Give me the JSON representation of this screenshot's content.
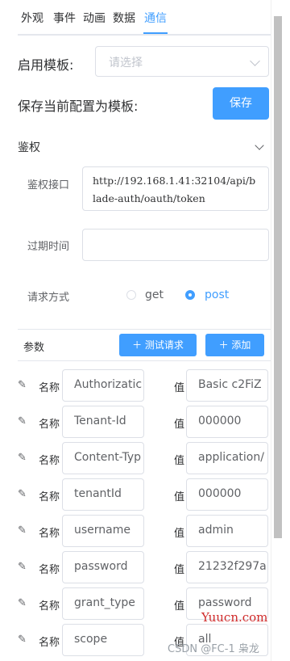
{
  "tabs": [
    "外观",
    "事件",
    "动画",
    "数据",
    "通信"
  ],
  "template": {
    "label": "启用模板:",
    "placeholder": "请选择"
  },
  "save_template": {
    "label": "保存当前配置为模板:",
    "button": "保存"
  },
  "auth": {
    "section_title": "鉴权",
    "api_label": "鉴权接口",
    "api_value": "http://192.168.1.41:32104/api/blade-auth/oauth/token",
    "expire_label": "过期时间",
    "expire_value": "",
    "method_label": "请求方式",
    "methods": [
      "get",
      "post"
    ],
    "selected_method": "post"
  },
  "params": {
    "title": "参数",
    "test_button": "测试请求",
    "add_button": "添加",
    "name_label": "名称",
    "value_label": "值",
    "rows": [
      {
        "name": "Authorizatic",
        "value": "Basic c2FiZ"
      },
      {
        "name": "Tenant-Id",
        "value": "000000"
      },
      {
        "name": "Content-Typ",
        "value": "application/"
      },
      {
        "name": "tenantId",
        "value": "000000"
      },
      {
        "name": "username",
        "value": "admin"
      },
      {
        "name": "password",
        "value": "21232f297a"
      },
      {
        "name": "grant_type",
        "value": "password"
      },
      {
        "name": "scope",
        "value": "all"
      }
    ]
  },
  "watermark": {
    "site": "Yuucn.com",
    "credit": "CSDN @FC-1 枭龙"
  },
  "colors": {
    "accent": "#409eff",
    "border": "#dcdfe6"
  }
}
